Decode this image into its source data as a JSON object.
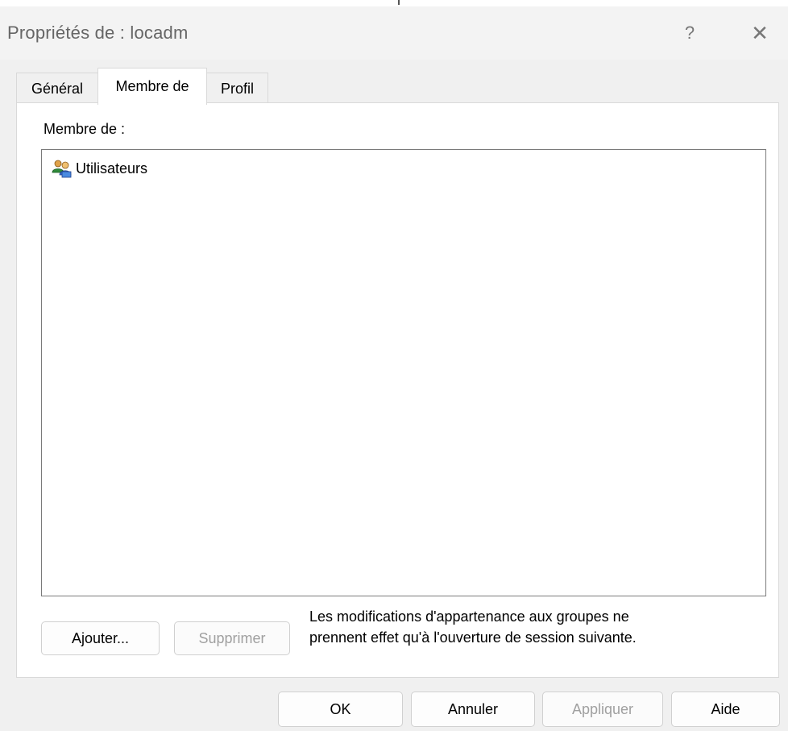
{
  "window": {
    "title": "Propriétés de : locadm",
    "help_glyph": "?",
    "close_glyph": "✕"
  },
  "tabs": [
    {
      "label": "Général",
      "active": false
    },
    {
      "label": "Membre de",
      "active": true
    },
    {
      "label": "Profil",
      "active": false
    }
  ],
  "membership": {
    "label": "Membre de :",
    "groups": [
      {
        "name": "Utilisateurs",
        "icon": "users-group-icon"
      }
    ],
    "add_button": "Ajouter...",
    "remove_button": "Supprimer",
    "note_line1": "Les modifications d'appartenance aux groupes ne",
    "note_line2": "prennent effet qu'à l'ouverture de session suivante."
  },
  "footer": {
    "ok": "OK",
    "cancel": "Annuler",
    "apply": "Appliquer",
    "help": "Aide"
  }
}
